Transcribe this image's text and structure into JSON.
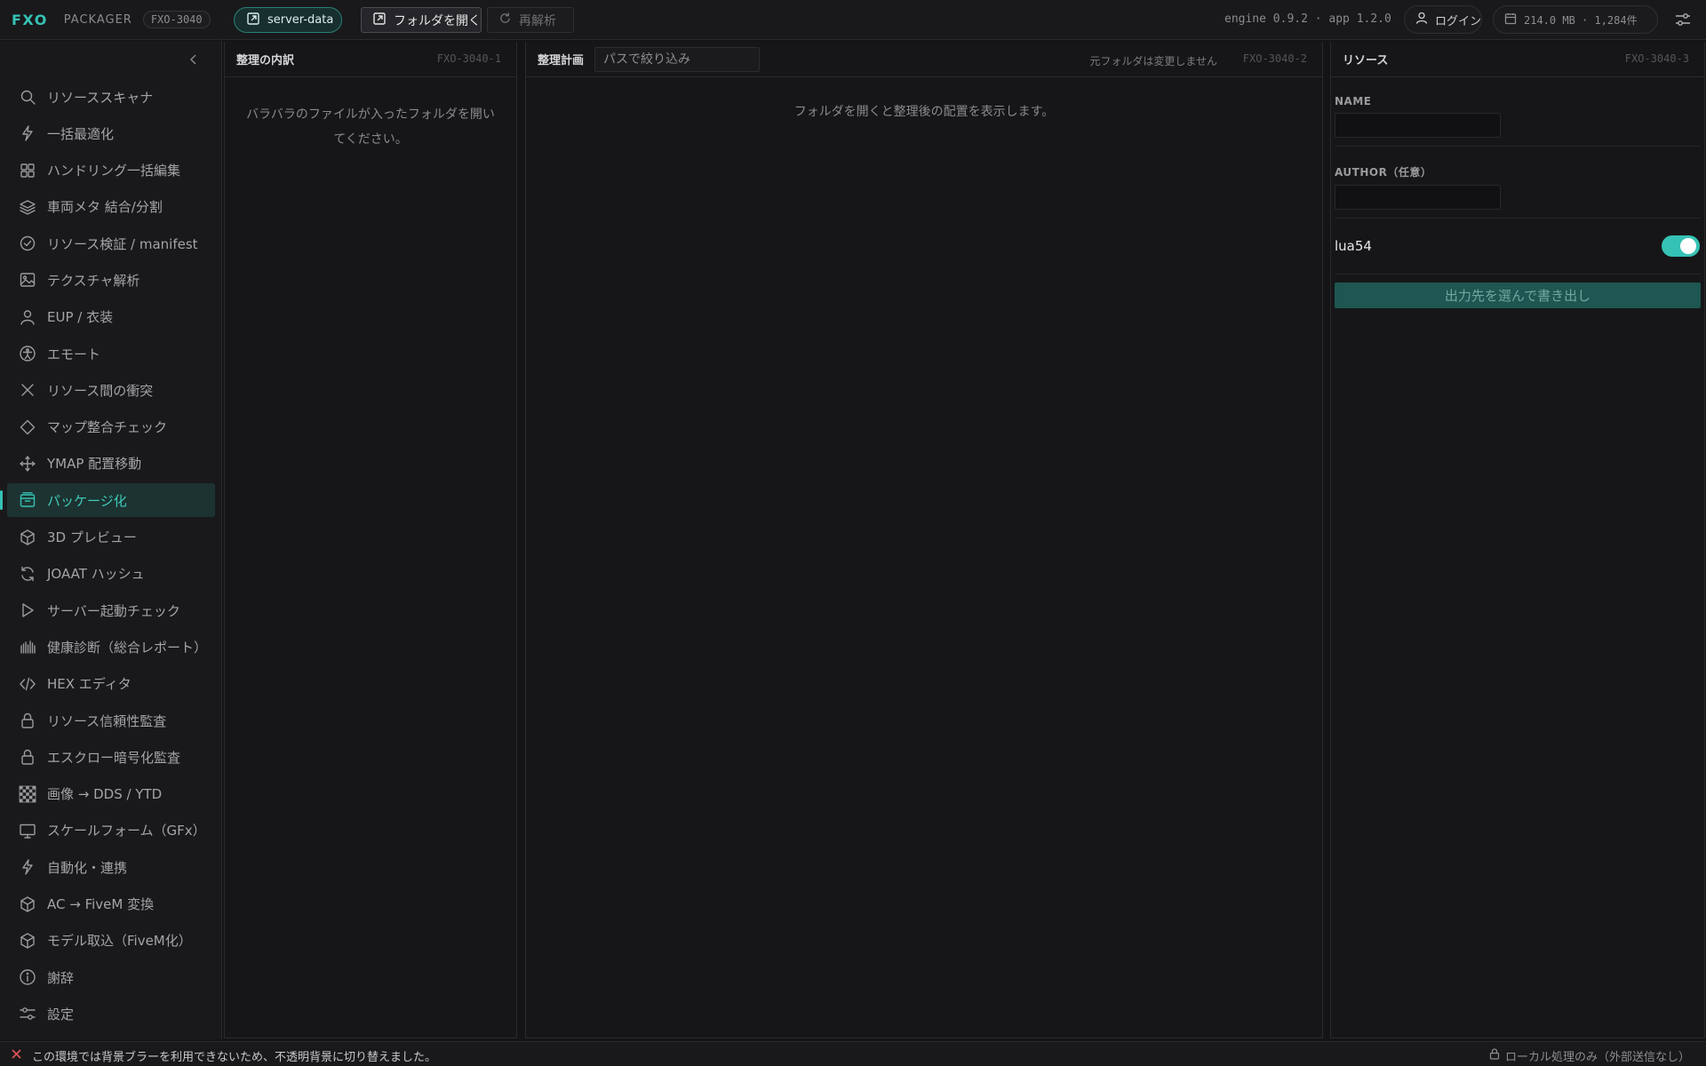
{
  "brand": {
    "name": "FXO",
    "product": "PACKAGER",
    "tag": "FXO-3040"
  },
  "toolbar": {
    "server_label": "server-data",
    "open_folder_label": "フォルダを開く",
    "reanalyze_label": "再解析",
    "engine_info": "engine 0.9.2 · app 1.2.0",
    "login_label": "ログイン",
    "storage_info": "214.0 MB · 1,284件"
  },
  "sidebar": {
    "items": [
      {
        "label": "リソーススキャナ",
        "icon": "search-icon"
      },
      {
        "label": "一括最適化",
        "icon": "bolt-icon"
      },
      {
        "label": "ハンドリング一括編集",
        "icon": "grid-icon"
      },
      {
        "label": "車両メタ 結合/分割",
        "icon": "layers-icon"
      },
      {
        "label": "リソース検証 / manifest",
        "icon": "check-circle-icon"
      },
      {
        "label": "テクスチャ解析",
        "icon": "image-icon"
      },
      {
        "label": "EUP / 衣装",
        "icon": "user-icon"
      },
      {
        "label": "エモート",
        "icon": "accessibility-icon"
      },
      {
        "label": "リソース間の衝突",
        "icon": "x-icon"
      },
      {
        "label": "マップ整合チェック",
        "icon": "diamond-icon"
      },
      {
        "label": "YMAP 配置移動",
        "icon": "move-icon"
      },
      {
        "label": "パッケージ化",
        "icon": "package-icon",
        "active": true
      },
      {
        "label": "3D プレビュー",
        "icon": "cube-icon"
      },
      {
        "label": "JOAAT ハッシュ",
        "icon": "refresh-icon"
      },
      {
        "label": "サーバー起動チェック",
        "icon": "play-icon"
      },
      {
        "label": "健康診断（総合レポート）",
        "icon": "bars-icon"
      },
      {
        "label": "HEX エディタ",
        "icon": "code-icon"
      },
      {
        "label": "リソース信頼性監査",
        "icon": "lock-icon"
      },
      {
        "label": "エスクロー暗号化監査",
        "icon": "lock-icon"
      },
      {
        "label": "画像 → DDS / YTD",
        "icon": "checker-icon"
      },
      {
        "label": "スケールフォーム（GFx）",
        "icon": "monitor-icon"
      },
      {
        "label": "自動化・連携",
        "icon": "bolt-icon"
      },
      {
        "label": "AC → FiveM 変換",
        "icon": "cube-icon"
      },
      {
        "label": "モデル取込（FiveM化）",
        "icon": "cube-icon"
      },
      {
        "label": "謝辞",
        "icon": "info-icon"
      },
      {
        "label": "設定",
        "icon": "sliders-icon"
      }
    ]
  },
  "panels": {
    "contents": {
      "title": "整理の内訳",
      "id": "FXO-3040-1",
      "empty": "バラバラのファイルが入ったフォルダを開いてください。"
    },
    "plan": {
      "title": "整理計画",
      "id": "FXO-3040-2",
      "filter_placeholder": "パスで絞り込み",
      "note": "元フォルダは変更しません",
      "empty": "フォルダを開くと整理後の配置を表示します。"
    },
    "resource": {
      "title": "リソース",
      "id": "FXO-3040-3",
      "name_label": "NAME",
      "name_value": "",
      "author_label": "AUTHOR（任意）",
      "author_value": "",
      "lua54_label": "lua54",
      "lua54_on": true,
      "export_label": "出力先を選んで書き出し"
    }
  },
  "status": {
    "message": "この環境では背景ブラーを利用できないため、不透明背景に切り替えました。",
    "local": "ローカル処理のみ（外部送信なし）"
  },
  "colors": {
    "accent": "#35c2b4",
    "error": "#e05555"
  }
}
